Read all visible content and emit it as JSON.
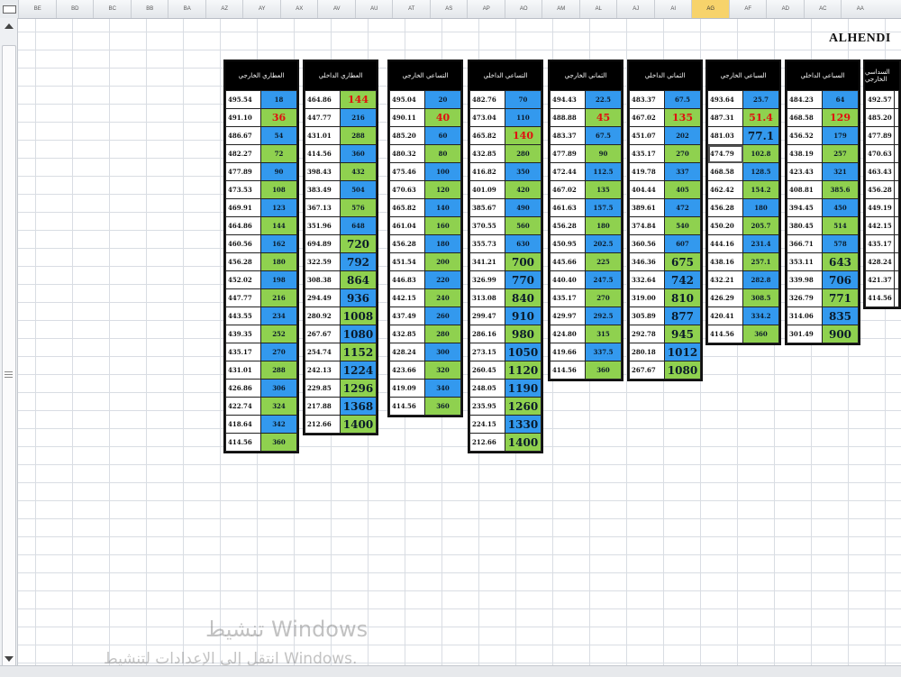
{
  "app": {
    "brand": "ALHENDI"
  },
  "columns": [
    "AA",
    "AC",
    "AD",
    "AF",
    "AG",
    "AI",
    "AJ",
    "AL",
    "AM",
    "AO",
    "AP",
    "AS",
    "AT",
    "AU",
    "AV",
    "AX",
    "AY",
    "AZ",
    "BA",
    "BB",
    "BC",
    "BD",
    "BE"
  ],
  "selected_column": "AG",
  "blocks": [
    {
      "title": "العطاري الخارجي",
      "rows": [
        [
          "495.54",
          "18",
          "b"
        ],
        [
          "491.10",
          "36",
          "g",
          "red"
        ],
        [
          "486.67",
          "54",
          "b"
        ],
        [
          "482.27",
          "72",
          "g"
        ],
        [
          "477.89",
          "90",
          "b"
        ],
        [
          "473.53",
          "108",
          "g"
        ],
        [
          "469.91",
          "123",
          "b"
        ],
        [
          "464.86",
          "144",
          "g"
        ],
        [
          "460.56",
          "162",
          "b"
        ],
        [
          "456.28",
          "180",
          "g"
        ],
        [
          "452.02",
          "198",
          "b"
        ],
        [
          "447.77",
          "216",
          "g"
        ],
        [
          "443.55",
          "234",
          "b"
        ],
        [
          "439.35",
          "252",
          "g"
        ],
        [
          "435.17",
          "270",
          "b"
        ],
        [
          "431.01",
          "288",
          "g"
        ],
        [
          "426.86",
          "306",
          "b"
        ],
        [
          "422.74",
          "324",
          "g"
        ],
        [
          "418.64",
          "342",
          "b"
        ],
        [
          "414.56",
          "360",
          "g"
        ]
      ]
    },
    {
      "title": "العطاري الداخلي",
      "rows": [
        [
          "464.86",
          "144",
          "g",
          "red"
        ],
        [
          "447.77",
          "216",
          "b"
        ],
        [
          "431.01",
          "288",
          "g"
        ],
        [
          "414.56",
          "360",
          "b"
        ],
        [
          "398.43",
          "432",
          "g"
        ],
        [
          "383.49",
          "504",
          "b"
        ],
        [
          "367.13",
          "576",
          "g"
        ],
        [
          "351.96",
          "648",
          "b"
        ],
        [
          "694.89",
          "720",
          "g",
          "big"
        ],
        [
          "322.59",
          "792",
          "b",
          "big"
        ],
        [
          "308.38",
          "864",
          "g",
          "big"
        ],
        [
          "294.49",
          "936",
          "b",
          "big"
        ],
        [
          "280.92",
          "1008",
          "g",
          "big"
        ],
        [
          "267.67",
          "1080",
          "b",
          "big"
        ],
        [
          "254.74",
          "1152",
          "g",
          "big"
        ],
        [
          "242.13",
          "1224",
          "b",
          "big"
        ],
        [
          "229.85",
          "1296",
          "g",
          "big"
        ],
        [
          "217.88",
          "1368",
          "b",
          "big"
        ],
        [
          "212.66",
          "1400",
          "g",
          "big"
        ]
      ]
    },
    {
      "title": "التساعي الخارجي",
      "rows": [
        [
          "495.04",
          "20",
          "b"
        ],
        [
          "490.11",
          "40",
          "g",
          "red"
        ],
        [
          "485.20",
          "60",
          "b"
        ],
        [
          "480.32",
          "80",
          "g"
        ],
        [
          "475.46",
          "100",
          "b"
        ],
        [
          "470.63",
          "120",
          "g"
        ],
        [
          "465.82",
          "140",
          "b"
        ],
        [
          "461.04",
          "160",
          "g"
        ],
        [
          "456.28",
          "180",
          "b"
        ],
        [
          "451.54",
          "200",
          "g"
        ],
        [
          "446.83",
          "220",
          "b"
        ],
        [
          "442.15",
          "240",
          "g"
        ],
        [
          "437.49",
          "260",
          "b"
        ],
        [
          "432.85",
          "280",
          "g"
        ],
        [
          "428.24",
          "300",
          "b"
        ],
        [
          "423.66",
          "320",
          "g"
        ],
        [
          "419.09",
          "340",
          "b"
        ],
        [
          "414.56",
          "360",
          "g"
        ]
      ]
    },
    {
      "title": "التساعي الداخلي",
      "rows": [
        [
          "482.76",
          "70",
          "b"
        ],
        [
          "473.04",
          "110",
          "b"
        ],
        [
          "465.82",
          "140",
          "g",
          "red"
        ],
        [
          "432.85",
          "280",
          "g"
        ],
        [
          "416.82",
          "350",
          "b"
        ],
        [
          "401.09",
          "420",
          "g"
        ],
        [
          "385.67",
          "490",
          "b"
        ],
        [
          "370.55",
          "560",
          "g"
        ],
        [
          "355.73",
          "630",
          "b"
        ],
        [
          "341.21",
          "700",
          "g",
          "big"
        ],
        [
          "326.99",
          "770",
          "b",
          "big"
        ],
        [
          "313.08",
          "840",
          "g",
          "big"
        ],
        [
          "299.47",
          "910",
          "b",
          "big"
        ],
        [
          "286.16",
          "980",
          "g",
          "big"
        ],
        [
          "273.15",
          "1050",
          "b",
          "big"
        ],
        [
          "260.45",
          "1120",
          "g",
          "big"
        ],
        [
          "248.05",
          "1190",
          "b",
          "big"
        ],
        [
          "235.95",
          "1260",
          "g",
          "big"
        ],
        [
          "224.15",
          "1330",
          "b",
          "big"
        ],
        [
          "212.66",
          "1400",
          "g",
          "big"
        ]
      ]
    },
    {
      "title": "الثماني الخارجي",
      "rows": [
        [
          "494.43",
          "22.5",
          "b"
        ],
        [
          "488.88",
          "45",
          "g",
          "red"
        ],
        [
          "483.37",
          "67.5",
          "b"
        ],
        [
          "477.89",
          "90",
          "g"
        ],
        [
          "472.44",
          "112.5",
          "b"
        ],
        [
          "467.02",
          "135",
          "g"
        ],
        [
          "461.63",
          "157.5",
          "b"
        ],
        [
          "456.28",
          "180",
          "g"
        ],
        [
          "450.95",
          "202.5",
          "b"
        ],
        [
          "445.66",
          "225",
          "g"
        ],
        [
          "440.40",
          "247.5",
          "b"
        ],
        [
          "435.17",
          "270",
          "g"
        ],
        [
          "429.97",
          "292.5",
          "b"
        ],
        [
          "424.80",
          "315",
          "g"
        ],
        [
          "419.66",
          "337.5",
          "b"
        ],
        [
          "414.56",
          "360",
          "g"
        ]
      ]
    },
    {
      "title": "الثماني الداخلي",
      "rows": [
        [
          "483.37",
          "67.5",
          "b"
        ],
        [
          "467.02",
          "135",
          "g",
          "red"
        ],
        [
          "451.07",
          "202",
          "b"
        ],
        [
          "435.17",
          "270",
          "g"
        ],
        [
          "419.78",
          "337",
          "b"
        ],
        [
          "404.44",
          "405",
          "g"
        ],
        [
          "389.61",
          "472",
          "b"
        ],
        [
          "374.84",
          "540",
          "g"
        ],
        [
          "360.56",
          "607",
          "b"
        ],
        [
          "346.36",
          "675",
          "g",
          "big"
        ],
        [
          "332.64",
          "742",
          "b",
          "big"
        ],
        [
          "319.00",
          "810",
          "g",
          "big"
        ],
        [
          "305.89",
          "877",
          "b",
          "big"
        ],
        [
          "292.78",
          "945",
          "g",
          "big"
        ],
        [
          "280.18",
          "1012",
          "b",
          "big"
        ],
        [
          "267.67",
          "1080",
          "g",
          "big"
        ]
      ]
    },
    {
      "title": "السباعي الخارجي",
      "rows": [
        [
          "493.64",
          "25.7",
          "b"
        ],
        [
          "487.31",
          "51.4",
          "g",
          "red"
        ],
        [
          "481.03",
          "77.1",
          "b",
          "big"
        ],
        [
          "474.79",
          "102.8",
          "g",
          "sel"
        ],
        [
          "468.58",
          "128.5",
          "b"
        ],
        [
          "462.42",
          "154.2",
          "g"
        ],
        [
          "456.28",
          "180",
          "b"
        ],
        [
          "450.20",
          "205.7",
          "g"
        ],
        [
          "444.16",
          "231.4",
          "b"
        ],
        [
          "438.16",
          "257.1",
          "g"
        ],
        [
          "432.21",
          "282.8",
          "b"
        ],
        [
          "426.29",
          "308.5",
          "g"
        ],
        [
          "420.41",
          "334.2",
          "b"
        ],
        [
          "414.56",
          "360",
          "g"
        ]
      ]
    },
    {
      "title": "السباعي الداخلي",
      "rows": [
        [
          "484.23",
          "64",
          "b"
        ],
        [
          "468.58",
          "129",
          "g",
          "red"
        ],
        [
          "456.52",
          "179",
          "b"
        ],
        [
          "438.19",
          "257",
          "g"
        ],
        [
          "423.43",
          "321",
          "b"
        ],
        [
          "408.81",
          "385.6",
          "g"
        ],
        [
          "394.45",
          "450",
          "b"
        ],
        [
          "380.45",
          "514",
          "g"
        ],
        [
          "366.71",
          "578",
          "b"
        ],
        [
          "353.11",
          "643",
          "g",
          "big"
        ],
        [
          "339.98",
          "706",
          "b",
          "big"
        ],
        [
          "326.79",
          "771",
          "g",
          "big"
        ],
        [
          "314.06",
          "835",
          "b",
          "big"
        ],
        [
          "301.49",
          "900",
          "g",
          "big"
        ]
      ]
    },
    {
      "title": "السداسي الخارجي",
      "rows": [
        [
          "492.57",
          ""
        ],
        [
          "485.20",
          ""
        ],
        [
          "477.89",
          ""
        ],
        [
          "470.63",
          ""
        ],
        [
          "463.43",
          ""
        ],
        [
          "456.28",
          ""
        ],
        [
          "449.19",
          ""
        ],
        [
          "442.15",
          ""
        ],
        [
          "435.17",
          ""
        ],
        [
          "428.24",
          ""
        ],
        [
          "421.37",
          ""
        ],
        [
          "414.56",
          ""
        ]
      ]
    }
  ],
  "watermark": {
    "line1": "تنشيط Windows",
    "line2": "انتقل إلى الإعدادات لتنشيط Windows."
  }
}
